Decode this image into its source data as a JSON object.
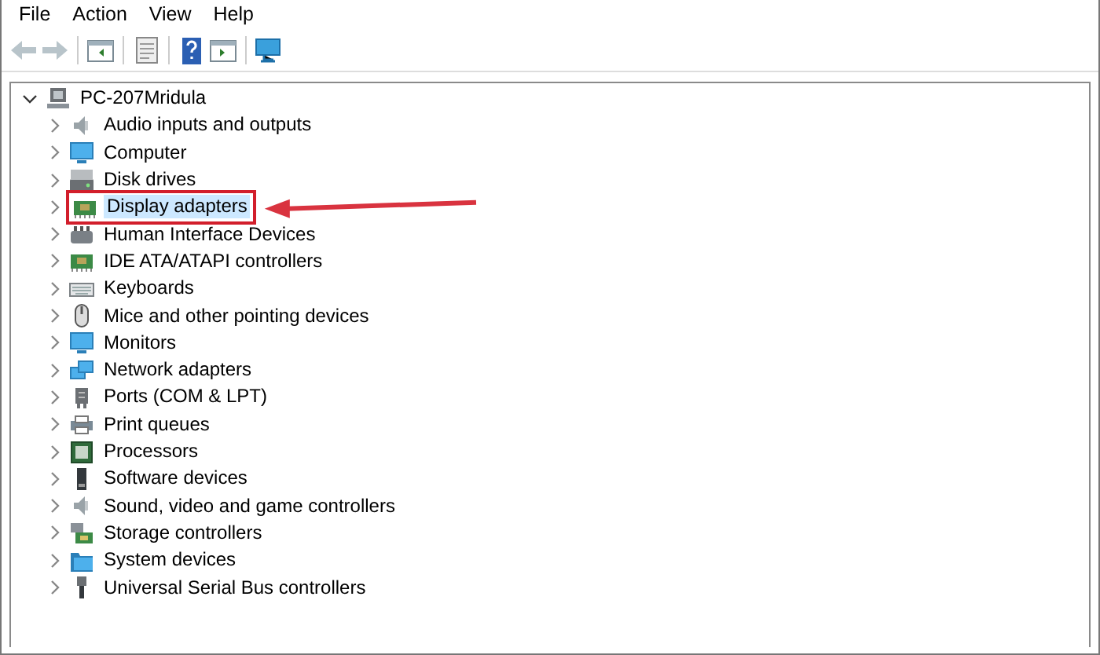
{
  "menu": [
    "File",
    "Action",
    "View",
    "Help"
  ],
  "toolbar": [
    {
      "kind": "back",
      "disabled": true
    },
    {
      "kind": "forward",
      "disabled": true
    },
    {
      "kind": "sep"
    },
    {
      "kind": "tree-pane",
      "disabled": false
    },
    {
      "kind": "sep"
    },
    {
      "kind": "properties",
      "disabled": false
    },
    {
      "kind": "sep"
    },
    {
      "kind": "help",
      "disabled": false
    },
    {
      "kind": "action-pane",
      "disabled": false
    },
    {
      "kind": "sep"
    },
    {
      "kind": "scan",
      "disabled": false
    }
  ],
  "tree": {
    "label": "PC-207Mridula",
    "expanded": true,
    "children": [
      {
        "label": "Audio inputs and outputs",
        "kind": "speaker",
        "expanded": false,
        "selected": false,
        "annotated": false
      },
      {
        "label": "Computer",
        "kind": "monitor",
        "expanded": false,
        "selected": false,
        "annotated": false
      },
      {
        "label": "Disk drives",
        "kind": "drive",
        "expanded": false,
        "selected": false,
        "annotated": false
      },
      {
        "label": "Display adapters",
        "kind": "card",
        "expanded": false,
        "selected": true,
        "annotated": true
      },
      {
        "label": "Human Interface Devices",
        "kind": "hid",
        "expanded": false,
        "selected": false,
        "annotated": false
      },
      {
        "label": "IDE ATA/ATAPI controllers",
        "kind": "card",
        "expanded": false,
        "selected": false,
        "annotated": false
      },
      {
        "label": "Keyboards",
        "kind": "keyboard",
        "expanded": false,
        "selected": false,
        "annotated": false
      },
      {
        "label": "Mice and other pointing devices",
        "kind": "mouse",
        "expanded": false,
        "selected": false,
        "annotated": false
      },
      {
        "label": "Monitors",
        "kind": "monitor",
        "expanded": false,
        "selected": false,
        "annotated": false
      },
      {
        "label": "Network adapters",
        "kind": "network",
        "expanded": false,
        "selected": false,
        "annotated": false
      },
      {
        "label": "Ports (COM & LPT)",
        "kind": "port",
        "expanded": false,
        "selected": false,
        "annotated": false
      },
      {
        "label": "Print queues",
        "kind": "printer",
        "expanded": false,
        "selected": false,
        "annotated": false
      },
      {
        "label": "Processors",
        "kind": "chip",
        "expanded": false,
        "selected": false,
        "annotated": false
      },
      {
        "label": "Software devices",
        "kind": "device",
        "expanded": false,
        "selected": false,
        "annotated": false
      },
      {
        "label": "Sound, video and game controllers",
        "kind": "speaker",
        "expanded": false,
        "selected": false,
        "annotated": false
      },
      {
        "label": "Storage controllers",
        "kind": "storage",
        "expanded": false,
        "selected": false,
        "annotated": false
      },
      {
        "label": "System devices",
        "kind": "folder",
        "expanded": false,
        "selected": false,
        "annotated": false
      },
      {
        "label": "Universal Serial Bus controllers",
        "kind": "usb",
        "expanded": false,
        "selected": false,
        "annotated": false
      }
    ]
  }
}
